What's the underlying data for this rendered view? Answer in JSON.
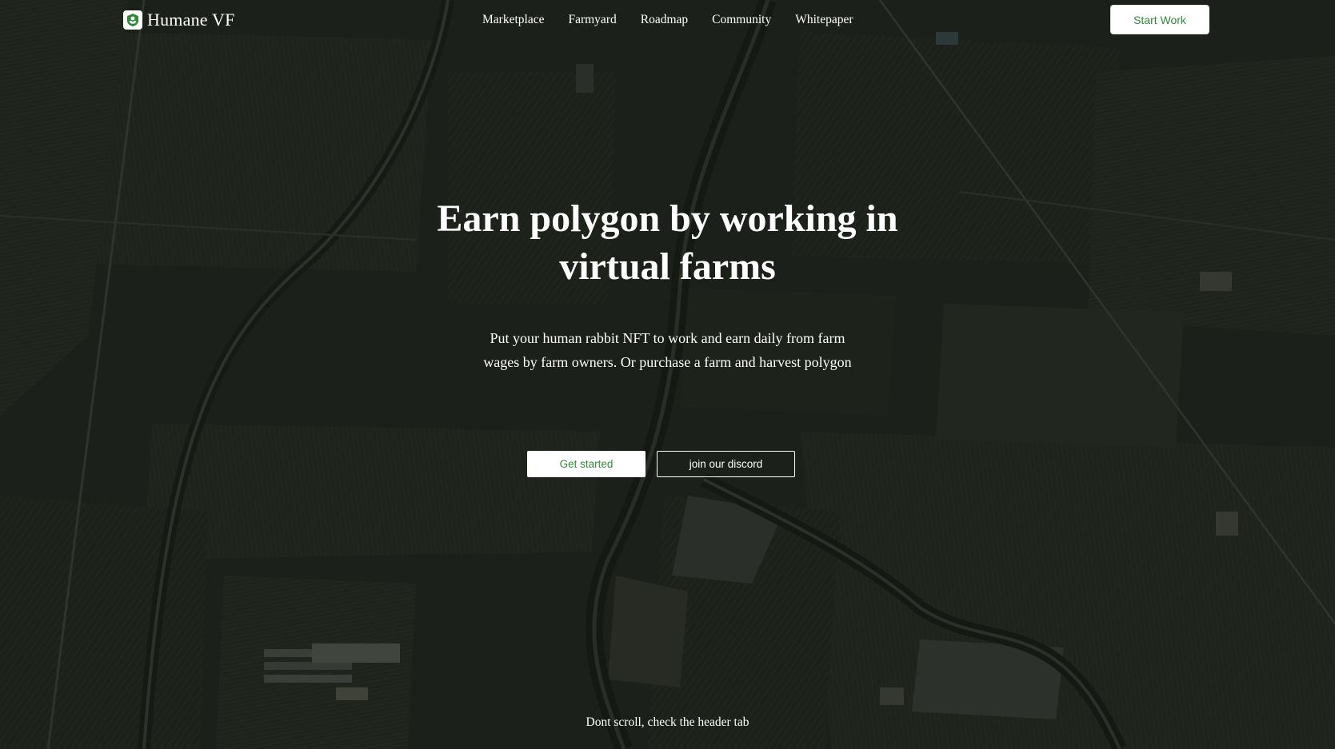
{
  "header": {
    "brand_name": "Humane VF",
    "logo_icon": "leaf-shield-icon",
    "nav": [
      {
        "label": "Marketplace"
      },
      {
        "label": "Farmyard"
      },
      {
        "label": "Roadmap"
      },
      {
        "label": "Community"
      },
      {
        "label": "Whitepaper"
      }
    ],
    "cta_label": "Start Work"
  },
  "hero": {
    "title": "Earn polygon by working in virtual farms",
    "subtitle": "Put your human rabbit NFT to work and earn daily from farm wages by farm owners. Or purchase a farm and harvest polygon",
    "primary_button": "Get started",
    "secondary_button": "join our discord"
  },
  "footer_hint": "Dont scroll, check the header tab",
  "colors": {
    "accent_green": "#2f8a3a",
    "field_dark": "#1f231d",
    "text": "#ffffff"
  }
}
